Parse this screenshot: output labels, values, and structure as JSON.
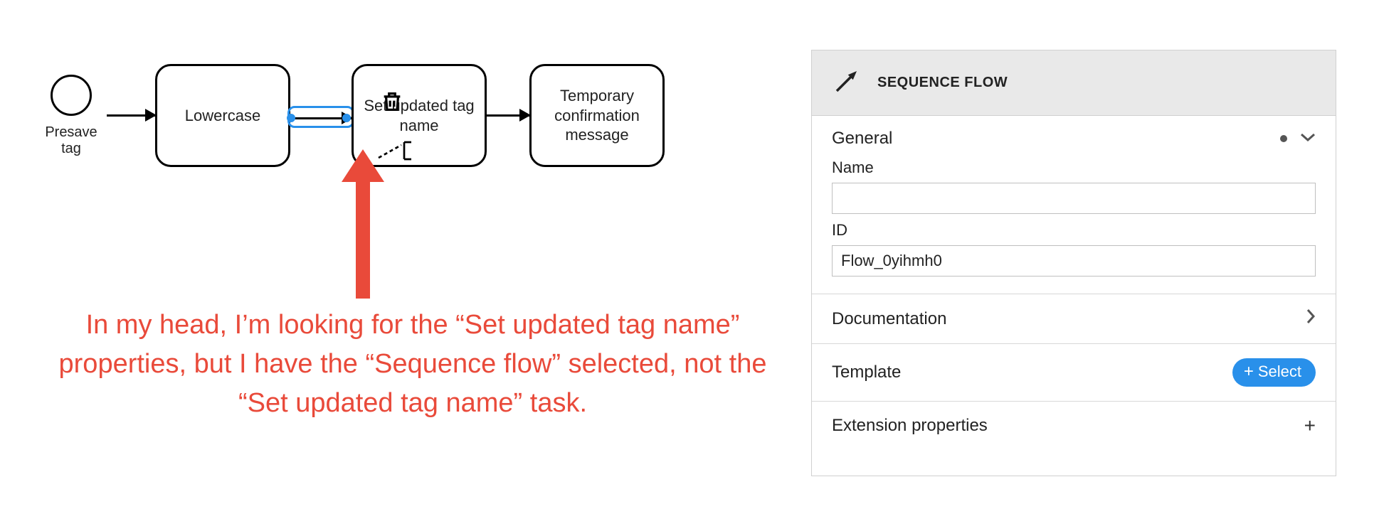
{
  "diagram": {
    "start_event_label": "Presave tag",
    "tasks": [
      {
        "label": "Lowercase"
      },
      {
        "label": "Set updated tag name"
      },
      {
        "label": "Temporary confirmation message"
      }
    ],
    "selected_element": "Sequence flow (between Lowercase and Set updated tag name)",
    "annotation_text": "In my head, I’m looking for the “Set updated tag name” properties, but I have the “Sequence flow” selected, not the “Set updated tag name” task.",
    "annotation_color": "#e94a3a"
  },
  "panel": {
    "title": "SEQUENCE FLOW",
    "sections": [
      {
        "key": "general",
        "label": "General",
        "expanded": true,
        "has_content_dot": true,
        "fields": [
          {
            "key": "name",
            "label": "Name",
            "value": ""
          },
          {
            "key": "id",
            "label": "ID",
            "value": "Flow_0yihmh0"
          }
        ]
      },
      {
        "key": "documentation",
        "label": "Documentation",
        "expanded": false
      },
      {
        "key": "template",
        "label": "Template",
        "button_label": "Select"
      },
      {
        "key": "extension_properties",
        "label": "Extension properties",
        "action": "add"
      }
    ]
  },
  "colors": {
    "accent": "#2990ea",
    "annotation": "#e94a3a",
    "panel_header_bg": "#e9e9e9"
  }
}
